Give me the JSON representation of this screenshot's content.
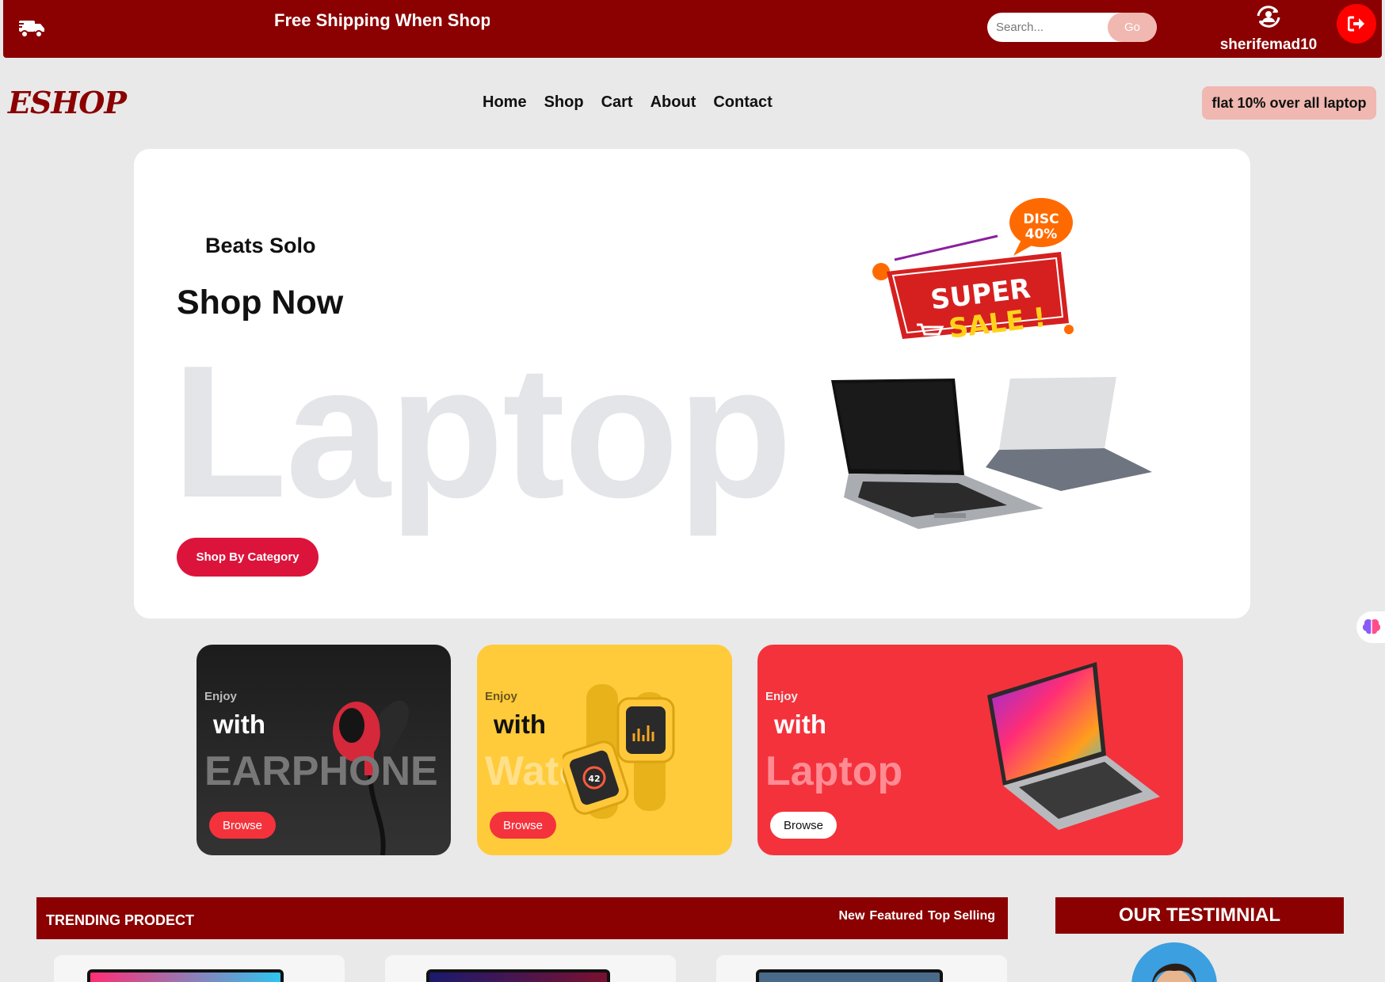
{
  "topbar": {
    "marquee": "Free Shipping When Shop",
    "search_placeholder": "Search...",
    "search_button": "Go",
    "username": "sherifemad10"
  },
  "nav": {
    "logo": "ESHOP",
    "links": [
      "Home",
      "Shop",
      "Cart",
      "About",
      "Contact"
    ],
    "promo": "flat 10% over all laptop"
  },
  "hero": {
    "subtitle": "Beats Solo",
    "title": "Shop Now",
    "big_text": "Laptop",
    "button": "Shop By Category",
    "badge_line1": "SUPER",
    "badge_line2": "SALE !",
    "disc_line1": "DISC",
    "disc_line2": "40%"
  },
  "cards": [
    {
      "enjoy": "Enjoy",
      "with": "with",
      "big": "EARPHONE",
      "button": "Browse"
    },
    {
      "enjoy": "Enjoy",
      "with": "with",
      "big": "Watch",
      "button": "Browse",
      "watch_face": "42"
    },
    {
      "enjoy": "Enjoy",
      "with": "with",
      "big": "Laptop",
      "button": "Browse"
    }
  ],
  "trending": {
    "title": "TRENDING PRODECT",
    "tabs": [
      "New",
      "Featured",
      "Top Selling"
    ]
  },
  "testimonial": {
    "title": "OUR TESTIMNIAL"
  },
  "colors": {
    "brand": "#8b0000",
    "accent": "#dc143c",
    "promo_bg": "#f0b8b0",
    "card_dark": "#1c1c1c",
    "card_yellow": "#ffcb3a",
    "card_red": "#f4323c"
  },
  "icons": [
    "truck-icon",
    "user-sync-icon",
    "logout-icon",
    "brain-icon"
  ]
}
